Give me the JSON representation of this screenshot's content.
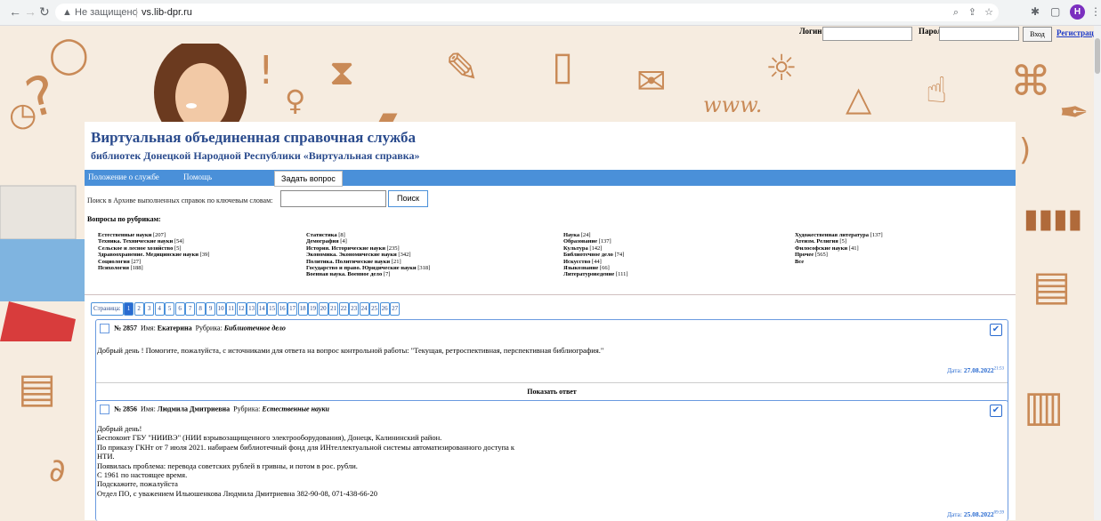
{
  "browser": {
    "not_secure": "Не защищено",
    "url": "vs.lib-dpr.ru",
    "profile_initial": "Н"
  },
  "login": {
    "login_label": "Логин:",
    "password_label": "Пароль:",
    "enter_button": "Вход",
    "register_link": "Регистрация"
  },
  "header": {
    "title": "Виртуальная объединенная справочная служба",
    "subtitle": "библиотек Донецкой Народной Республики «Виртуальная справка»"
  },
  "menu": {
    "item1": "Положение о службе",
    "item2": "Помощь",
    "ask_button": "Задать вопрос"
  },
  "search": {
    "label": "Поиск в Архиве выполненных справок по ключевым словам:",
    "button": "Поиск"
  },
  "rubrics_heading": "Вопросы по рубрикам:",
  "rubrics": {
    "col1": [
      "Естественные науки [207]",
      "Техника. Технические науки [54]",
      "Сельское и лесное хозяйство [5]",
      "Здравоохранение. Медицинские науки [39]",
      "Социология [27]",
      "Психология [188]"
    ],
    "col2": [
      "Статистика [8]",
      "Демография [4]",
      "История. Исторические науки [235]",
      "Экономика. Экономические науки [342]",
      "Политика. Политические науки [21]",
      "Государство и право. Юридические науки [318]",
      "Военная наука. Военное дело [7]"
    ],
    "col3": [
      "Наука [24]",
      "Образование [137]",
      "Культура [142]",
      "Библиотечное дело [74]",
      "Искусство [44]",
      "Языкознание [66]",
      "Литературоведение [111]"
    ],
    "col4": [
      "Художественная литература [137]",
      "Атеизм. Религия [5]",
      "Философские науки [41]",
      "Прочее [565]",
      "Все"
    ]
  },
  "pagination": {
    "label": "Страница:",
    "pages": [
      "1",
      "2",
      "3",
      "4",
      "5",
      "6",
      "7",
      "8",
      "9",
      "10",
      "11",
      "12",
      "13",
      "14",
      "15",
      "16",
      "17",
      "18",
      "19",
      "20",
      "21",
      "22",
      "23",
      "24",
      "25",
      "26",
      "27"
    ],
    "active": "1"
  },
  "questions": [
    {
      "num": "№ 2857",
      "name_label": "Имя:",
      "name": "Екатерина",
      "rubric_label": "Рубрика:",
      "rubric": "Библиотечное дело",
      "text": [
        "Добрый день ! Помогите, пожалуйста, с источниками для ответа на вопрос контрольной работы: \"Текущая, ретроспективная, перспективная библиография.\""
      ],
      "date_label": "Дата:",
      "date": "27.08.2022",
      "time": "21:53",
      "show_answer": "Показать ответ"
    },
    {
      "num": "№ 2856",
      "name_label": "Имя:",
      "name": "Людмила Дмитриевна",
      "rubric_label": "Рубрика:",
      "rubric": "Естественные науки",
      "text": [
        "Добрый день!",
        "Беспокоит ГБУ \"НИИВЭ\" (НИИ взрывозащищенного электрооборудования), Донецк, Калининский район.",
        "По приказу ГКНт от 7 июля 2021. набираем библиотечный фонд для ИНтеллектуальной системы автоматизированного доступа к",
        "НТИ.",
        "Появилась проблема: перевода советских рублей в гривны, и потом в рос. рубли.",
        "С 1961 по настоящее время.",
        "Подскажите, пожалуйста",
        "Отдел ПО, с уважением Ильюшенкова Людмила Дмитриевна 382-90-08, 071-438-66-20"
      ],
      "date_label": "Дата:",
      "date": "25.08.2022",
      "time": "09:39"
    }
  ]
}
